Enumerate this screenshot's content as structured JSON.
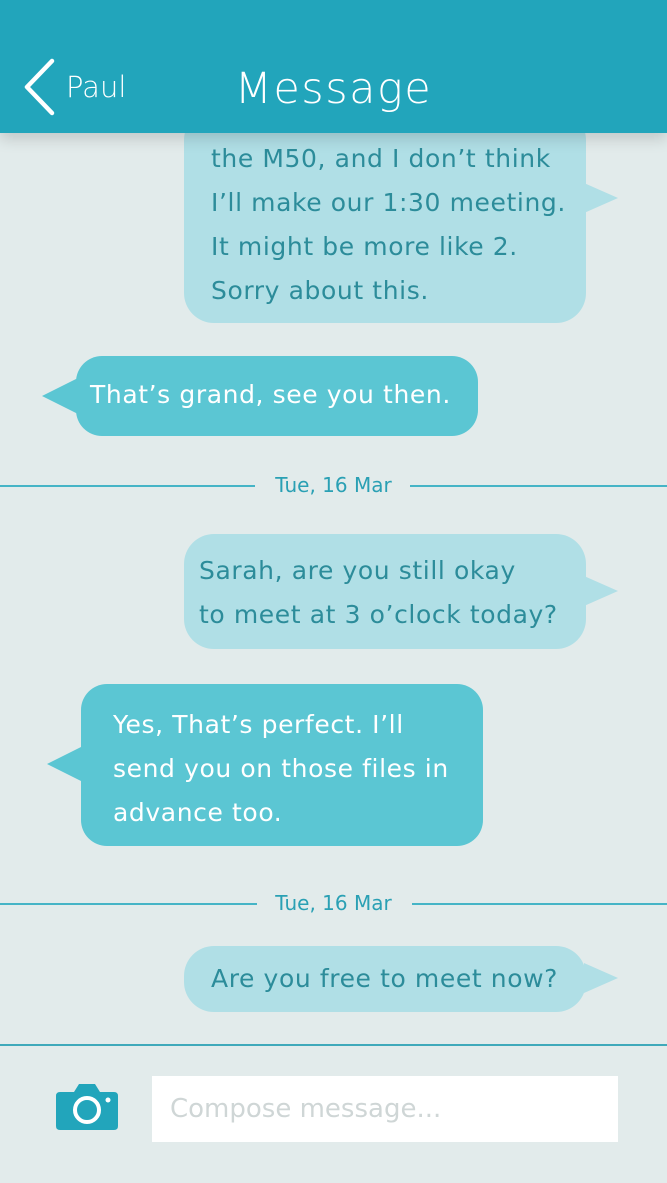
{
  "header": {
    "back_label": "Paul",
    "title": "Message"
  },
  "messages": [
    {
      "direction": "outgoing",
      "lines": [
        "the M50, and I don’t think",
        "I’ll make our 1:30 meeting.",
        "It might be more like 2.",
        "Sorry about this."
      ]
    },
    {
      "direction": "incoming",
      "lines": [
        "That’s grand, see you then."
      ]
    },
    {
      "direction": "outgoing",
      "lines": [
        "Sarah, are you still okay",
        "to meet at 3 o’clock today?"
      ]
    },
    {
      "direction": "incoming",
      "lines": [
        "Yes, That’s perfect. I’ll",
        "send you on those files in",
        "advance too."
      ]
    },
    {
      "direction": "outgoing",
      "lines": [
        "Are you free to meet now?"
      ]
    }
  ],
  "separators": [
    "Tue, 16 Mar",
    "Tue, 16 Mar"
  ],
  "composer": {
    "placeholder": "Compose message...",
    "camera_icon": "camera-icon"
  },
  "colors": {
    "header": "#22a5bb",
    "background": "#e2ebeb",
    "outgoing_bubble": "#b0dfe6",
    "outgoing_text": "#2c8c9a",
    "incoming_bubble": "#5bc6d3",
    "incoming_text": "#ffffff"
  }
}
